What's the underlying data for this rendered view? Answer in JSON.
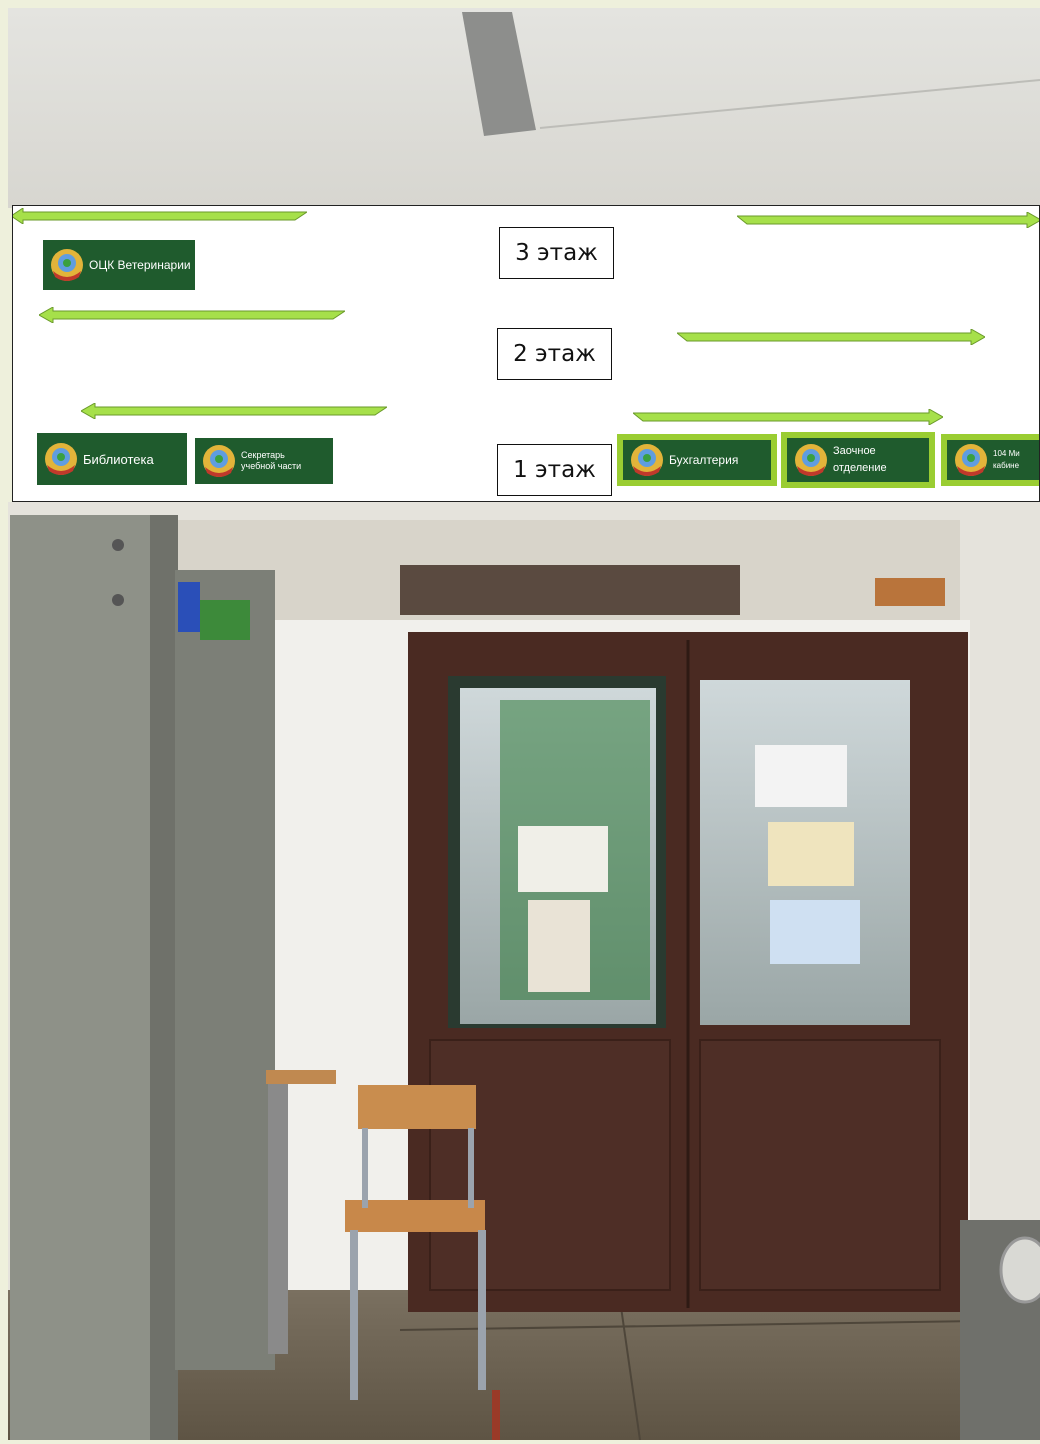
{
  "floors": {
    "floor3": "3 этаж",
    "floor2": "2 этаж",
    "floor1": "1 этаж"
  },
  "rooms": {
    "vet": "ОЦК Ветеринарии",
    "library": "Библиотека",
    "secretary": "Секретарь\nучебной части",
    "accounting": "Бухгалтерия",
    "correspondence": "Заочное\nотделение",
    "cabinet": "104 Ми\nкабине"
  },
  "colors": {
    "arrow_fill": "#a6e04a",
    "label_bg": "#1f5b2d",
    "label_accent": "#9acd32",
    "door": "#4a2a22"
  }
}
